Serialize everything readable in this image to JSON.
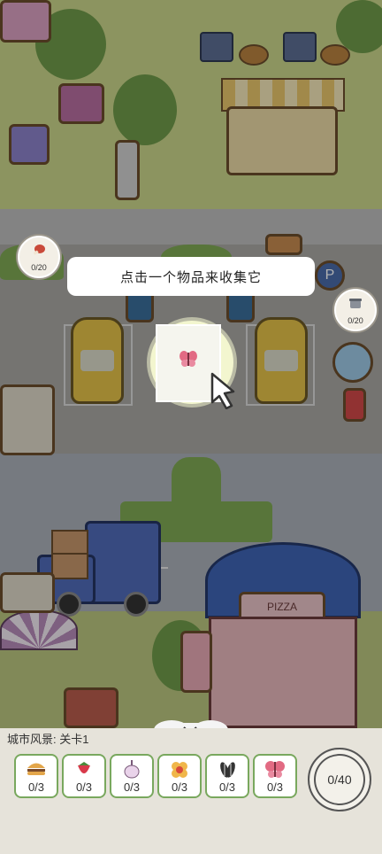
{
  "tooltip": {
    "text": "点击一个物品来收集它"
  },
  "scene_badges": [
    {
      "icon": "meat-icon",
      "progress": "0/20"
    },
    {
      "icon": "pot-icon",
      "progress": "0/20"
    }
  ],
  "shop_sign": {
    "text": "PIZZA"
  },
  "panel": {
    "level_title": "城市风景: 关卡1",
    "items": [
      {
        "icon": "burger-icon",
        "count": "0/3"
      },
      {
        "icon": "strawberry-icon",
        "count": "0/3"
      },
      {
        "icon": "garlic-icon",
        "count": "0/3"
      },
      {
        "icon": "flower-icon",
        "count": "0/3"
      },
      {
        "icon": "seed-icon",
        "count": "0/3"
      },
      {
        "icon": "butterfly-icon",
        "count": "0/3"
      }
    ],
    "total_counter": "0/40"
  },
  "colors": {
    "slot_border": "#79a85e",
    "highlight": "#f3f6cf",
    "butterfly": "#e26a83"
  }
}
